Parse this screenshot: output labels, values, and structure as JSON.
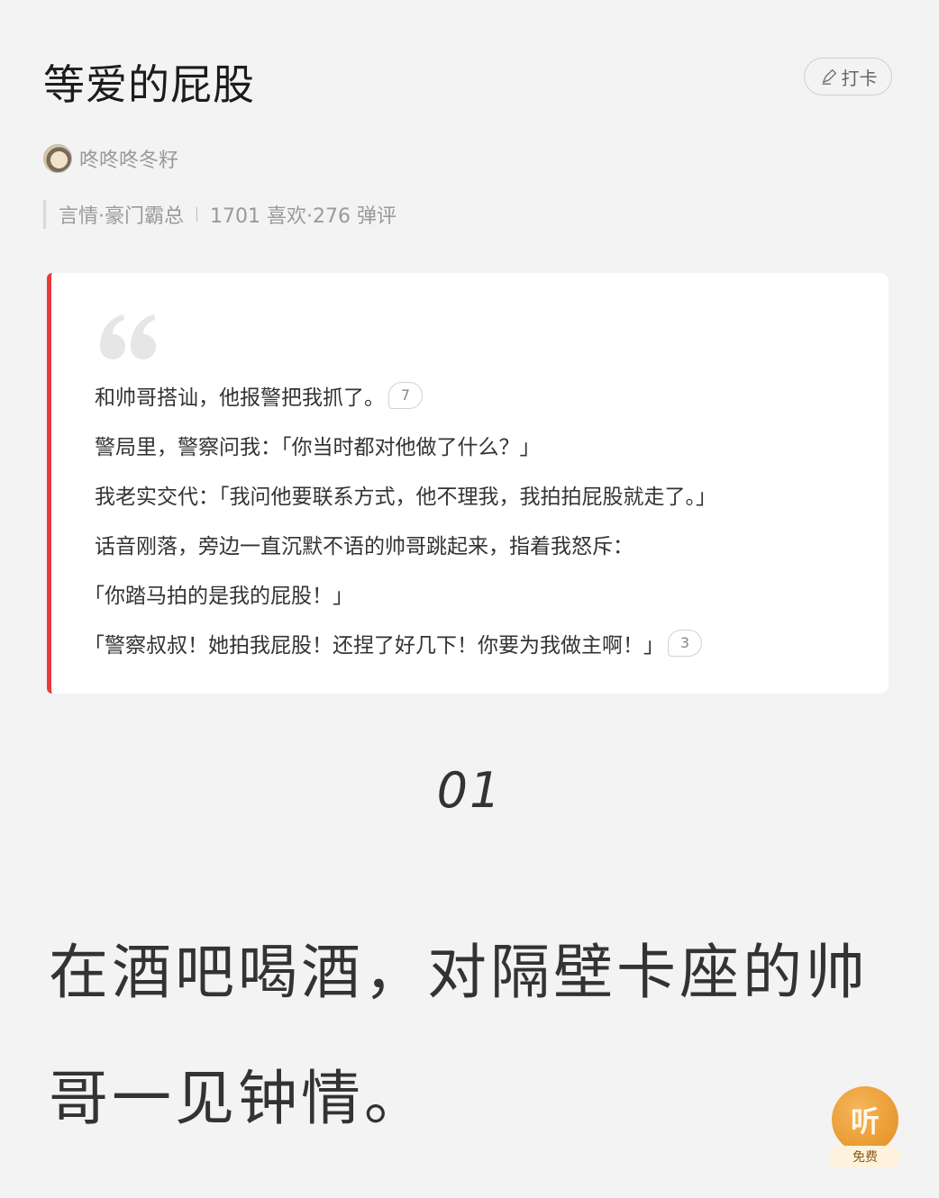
{
  "header": {
    "title": "等爱的屁股",
    "checkin_label": "打卡"
  },
  "author": {
    "name": "咚咚咚冬籽"
  },
  "meta": {
    "tags": "言情·豪门霸总",
    "stats": "1701 喜欢·276 弹评"
  },
  "quote": {
    "lines": [
      {
        "text": "和帅哥搭讪，他报警把我抓了。",
        "comments": "7"
      },
      {
        "text": "警局里，警察问我：「你当时都对他做了什么？」"
      },
      {
        "text": "我老实交代：「我问他要联系方式，他不理我，我拍拍屁股就走了。」"
      },
      {
        "text": "话音刚落，旁边一直沉默不语的帅哥跳起来，指着我怒斥："
      },
      {
        "text": "「你踏马拍的是我的屁股！」"
      },
      {
        "text": "「警察叔叔！她拍我屁股！还捏了好几下！你要为我做主啊！」",
        "comments": "3"
      }
    ],
    "accent_color": "#e83a3a"
  },
  "chapter": {
    "number": "01"
  },
  "body": {
    "paragraph": "在酒吧喝酒，对隔壁卡座的帅哥一见钟情。"
  },
  "listen": {
    "icon_label": "听",
    "tag": "免费"
  }
}
